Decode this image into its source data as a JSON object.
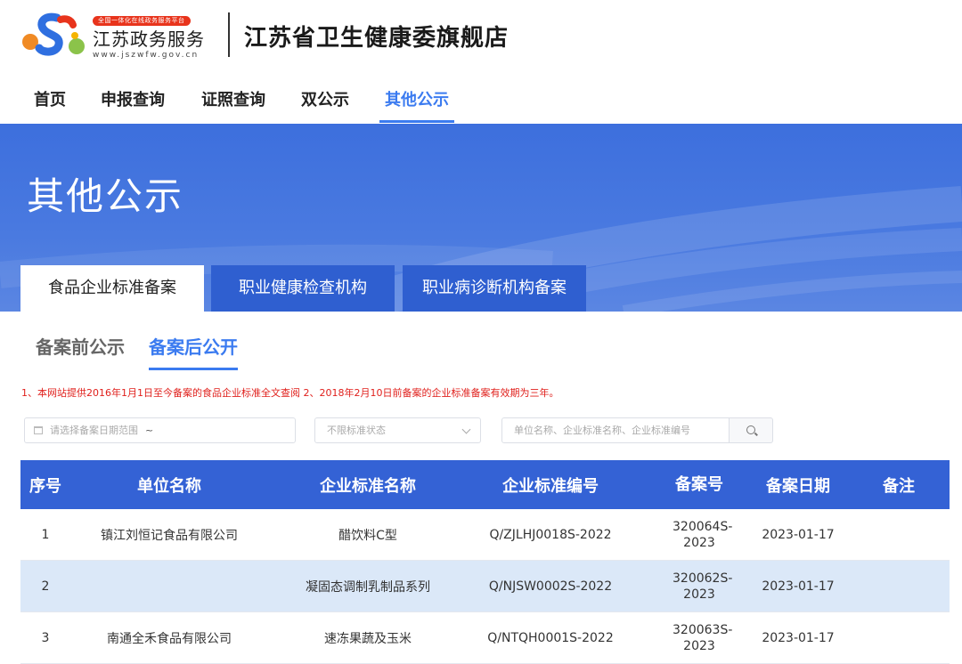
{
  "header": {
    "logo_badge": "全国一体化在线政务服务平台",
    "logo_name": "江苏政务服务",
    "logo_url": "www.jszwfw.gov.cn",
    "store_title": "江苏省卫生健康委旗舰店"
  },
  "nav": [
    "首页",
    "申报查询",
    "证照查询",
    "双公示",
    "其他公示"
  ],
  "nav_active_index": 4,
  "banner": {
    "title": "其他公示",
    "tabs": [
      "食品企业标准备案",
      "职业健康检查机构",
      "职业病诊断机构备案"
    ],
    "active_tab_index": 0
  },
  "sub_tabs": [
    "备案前公示",
    "备案后公开"
  ],
  "sub_active_index": 1,
  "notice": "1、本网站提供2016年1月1日至今备案的食品企业标准全文查阅 2、2018年2月10日前备案的企业标准备案有效期为三年。",
  "filters": {
    "date_placeholder": "请选择备案日期范围",
    "date_separator": "~",
    "status_placeholder": "不限标准状态",
    "search_placeholder": "单位名称、企业标准名称、企业标准编号"
  },
  "table": {
    "headers": [
      "序号",
      "单位名称",
      "企业标准名称",
      "企业标准编号",
      "备案号",
      "备案日期",
      "备注"
    ],
    "rows": [
      [
        "1",
        "镇江刘恒记食品有限公司",
        "醋饮料C型",
        "Q/ZJLHJ0018S-2022",
        "320064S-2023",
        "2023-01-17",
        ""
      ],
      [
        "2",
        "",
        "凝固态调制乳制品系列",
        "Q/NJSW0002S-2022",
        "320062S-2023",
        "2023-01-17",
        ""
      ],
      [
        "3",
        "南通全禾食品有限公司",
        "速冻果蔬及玉米",
        "Q/NTQH0001S-2022",
        "320063S-2023",
        "2023-01-17",
        ""
      ]
    ]
  },
  "colors": {
    "accent": "#3b7bf0",
    "banner": "#4574e0",
    "table_header": "#3462d5",
    "row_highlight": "#dbe8f8",
    "notice": "#e0201c"
  }
}
